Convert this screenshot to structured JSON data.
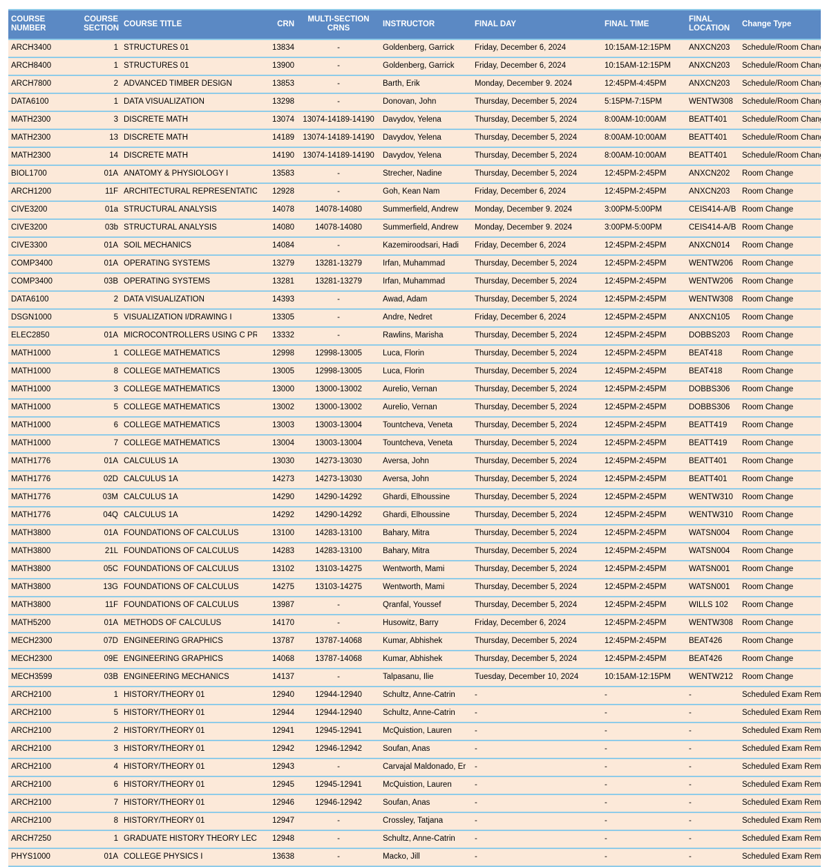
{
  "table": {
    "columns": [
      {
        "key": "course_number",
        "label": "COURSE\nNUMBER",
        "align": "left"
      },
      {
        "key": "course_section",
        "label": "COURSE\nSECTION",
        "align": "right"
      },
      {
        "key": "course_title",
        "label": "COURSE TITLE",
        "align": "left"
      },
      {
        "key": "crn",
        "label": "CRN",
        "align": "right"
      },
      {
        "key": "multi_section",
        "label": "MULTI-SECTION\nCRNS",
        "align": "center"
      },
      {
        "key": "instructor",
        "label": "INSTRUCTOR",
        "align": "left"
      },
      {
        "key": "final_day",
        "label": "FINAL DAY",
        "align": "left"
      },
      {
        "key": "final_time",
        "label": "FINAL TIME",
        "align": "left"
      },
      {
        "key": "final_location",
        "label": "FINAL\nLOCATION",
        "align": "left"
      },
      {
        "key": "change_type",
        "label": "Change Type",
        "align": "left"
      }
    ],
    "colors": {
      "header_background": "#5b89c4",
      "header_text": "#ffffff",
      "row_background": "#fce9d9",
      "row_separator": "#8ecbe8",
      "body_text": "#000000"
    },
    "rows": [
      {
        "course_number": "ARCH3400",
        "course_section": "1",
        "course_title": "STRUCTURES 01",
        "crn": "13834",
        "multi_section": "-",
        "instructor": "Goldenberg, Garrick",
        "final_day": "Friday, December 6, 2024",
        "final_time": "10:15AM-12:15PM",
        "final_location": "ANXCN203",
        "change_type": "Schedule/Room Change"
      },
      {
        "course_number": "ARCH8400",
        "course_section": "1",
        "course_title": "STRUCTURES 01",
        "crn": "13900",
        "multi_section": "-",
        "instructor": "Goldenberg, Garrick",
        "final_day": "Friday, December 6, 2024",
        "final_time": "10:15AM-12:15PM",
        "final_location": "ANXCN203",
        "change_type": "Schedule/Room Change"
      },
      {
        "course_number": "ARCH7800",
        "course_section": "2",
        "course_title": "ADVANCED TIMBER DESIGN",
        "crn": "13853",
        "multi_section": "-",
        "instructor": "Barth, Erik",
        "final_day": "Monday, December 9. 2024",
        "final_time": "12:45PM-4:45PM",
        "final_location": "ANXCN203",
        "change_type": "Schedule/Room Change"
      },
      {
        "course_number": "DATA6100",
        "course_section": "1",
        "course_title": "DATA VISUALIZATION",
        "crn": "13298",
        "multi_section": "-",
        "instructor": "Donovan, John",
        "final_day": "Thursday, December 5, 2024",
        "final_time": "5:15PM-7:15PM",
        "final_location": "WENTW308",
        "change_type": "Schedule/Room Change"
      },
      {
        "course_number": "MATH2300",
        "course_section": "3",
        "course_title": "DISCRETE MATH",
        "crn": "13074",
        "multi_section": "13074-14189-14190",
        "instructor": "Davydov, Yelena",
        "final_day": "Thursday, December 5, 2024",
        "final_time": "8:00AM-10:00AM",
        "final_location": "BEATT401",
        "change_type": "Schedule/Room Change"
      },
      {
        "course_number": "MATH2300",
        "course_section": "13",
        "course_title": "DISCRETE MATH",
        "crn": "14189",
        "multi_section": "13074-14189-14190",
        "instructor": "Davydov, Yelena",
        "final_day": "Thursday, December 5, 2024",
        "final_time": "8:00AM-10:00AM",
        "final_location": "BEATT401",
        "change_type": "Schedule/Room Change"
      },
      {
        "course_number": "MATH2300",
        "course_section": "14",
        "course_title": "DISCRETE MATH",
        "crn": "14190",
        "multi_section": "13074-14189-14190",
        "instructor": "Davydov, Yelena",
        "final_day": "Thursday, December 5, 2024",
        "final_time": "8:00AM-10:00AM",
        "final_location": "BEATT401",
        "change_type": "Schedule/Room Change"
      },
      {
        "course_number": "BIOL1700",
        "course_section": "01A",
        "course_title": "ANATOMY & PHYSIOLOGY I",
        "crn": "13583",
        "multi_section": "-",
        "instructor": "Strecher, Nadine",
        "final_day": "Thursday, December 5, 2024",
        "final_time": "12:45PM-2:45PM",
        "final_location": "ANXCN202",
        "change_type": "Room Change"
      },
      {
        "course_number": "ARCH1200",
        "course_section": "11F",
        "course_title": "ARCHITECTURAL REPRESENTATIC",
        "crn": "12928",
        "multi_section": "-",
        "instructor": "Goh, Kean Nam",
        "final_day": "Friday, December 6, 2024",
        "final_time": "12:45PM-2:45PM",
        "final_location": "ANXCN203",
        "change_type": "Room Change"
      },
      {
        "course_number": "CIVE3200",
        "course_section": "01a",
        "course_title": "STRUCTURAL ANALYSIS",
        "crn": "14078",
        "multi_section": "14078-14080",
        "instructor": "Summerfield, Andrew",
        "final_day": "Monday, December 9. 2024",
        "final_time": "3:00PM-5:00PM",
        "final_location": "CEIS414-A/B",
        "change_type": "Room Change"
      },
      {
        "course_number": "CIVE3200",
        "course_section": "03b",
        "course_title": "STRUCTURAL ANALYSIS",
        "crn": "14080",
        "multi_section": "14078-14080",
        "instructor": "Summerfield, Andrew",
        "final_day": "Monday, December 9. 2024",
        "final_time": "3:00PM-5:00PM",
        "final_location": "CEIS414-A/B",
        "change_type": "Room Change"
      },
      {
        "course_number": "CIVE3300",
        "course_section": "01A",
        "course_title": "SOIL MECHANICS",
        "crn": "14084",
        "multi_section": "-",
        "instructor": "Kazemiroodsari, Hadi",
        "final_day": "Friday, December 6, 2024",
        "final_time": "12:45PM-2:45PM",
        "final_location": "ANXCN014",
        "change_type": "Room Change"
      },
      {
        "course_number": "COMP3400",
        "course_section": "01A",
        "course_title": "OPERATING SYSTEMS",
        "crn": "13279",
        "multi_section": "13281-13279",
        "instructor": "Irfan, Muhammad",
        "final_day": "Thursday, December 5, 2024",
        "final_time": "12:45PM-2:45PM",
        "final_location": "WENTW206",
        "change_type": "Room Change"
      },
      {
        "course_number": "COMP3400",
        "course_section": "03B",
        "course_title": "OPERATING SYSTEMS",
        "crn": "13281",
        "multi_section": "13281-13279",
        "instructor": "Irfan, Muhammad",
        "final_day": "Thursday, December 5, 2024",
        "final_time": "12:45PM-2:45PM",
        "final_location": "WENTW206",
        "change_type": "Room Change"
      },
      {
        "course_number": "DATA6100",
        "course_section": "2",
        "course_title": "DATA VISUALIZATION",
        "crn": "14393",
        "multi_section": "-",
        "instructor": "Awad, Adam",
        "final_day": "Thursday, December 5, 2024",
        "final_time": "12:45PM-2:45PM",
        "final_location": "WENTW308",
        "change_type": "Room Change"
      },
      {
        "course_number": "DSGN1000",
        "course_section": "5",
        "course_title": "VISUALIZATION I/DRAWING I",
        "crn": "13305",
        "multi_section": "-",
        "instructor": "Andre, Nedret",
        "final_day": "Friday, December 6, 2024",
        "final_time": "12:45PM-2:45PM",
        "final_location": "ANXCN105",
        "change_type": "Room Change"
      },
      {
        "course_number": "ELEC2850",
        "course_section": "01A",
        "course_title": "MICROCONTROLLERS USING C PR",
        "crn": "13332",
        "multi_section": "-",
        "instructor": "Rawlins, Marisha",
        "final_day": "Thursday, December 5, 2024",
        "final_time": "12:45PM-2:45PM",
        "final_location": "DOBBS203",
        "change_type": "Room Change"
      },
      {
        "course_number": "MATH1000",
        "course_section": "1",
        "course_title": "COLLEGE MATHEMATICS",
        "crn": "12998",
        "multi_section": "12998-13005",
        "instructor": "Luca, Florin",
        "final_day": "Thursday, December 5, 2024",
        "final_time": "12:45PM-2:45PM",
        "final_location": "BEAT418",
        "change_type": "Room Change"
      },
      {
        "course_number": "MATH1000",
        "course_section": "8",
        "course_title": "COLLEGE MATHEMATICS",
        "crn": "13005",
        "multi_section": "12998-13005",
        "instructor": "Luca, Florin",
        "final_day": "Thursday, December 5, 2024",
        "final_time": "12:45PM-2:45PM",
        "final_location": "BEAT418",
        "change_type": "Room Change"
      },
      {
        "course_number": "MATH1000",
        "course_section": "3",
        "course_title": "COLLEGE MATHEMATICS",
        "crn": "13000",
        "multi_section": "13000-13002",
        "instructor": "Aurelio, Vernan",
        "final_day": "Thursday, December 5, 2024",
        "final_time": "12:45PM-2:45PM",
        "final_location": "DOBBS306",
        "change_type": "Room Change"
      },
      {
        "course_number": "MATH1000",
        "course_section": "5",
        "course_title": "COLLEGE MATHEMATICS",
        "crn": "13002",
        "multi_section": "13000-13002",
        "instructor": "Aurelio, Vernan",
        "final_day": "Thursday, December 5, 2024",
        "final_time": "12:45PM-2:45PM",
        "final_location": "DOBBS306",
        "change_type": "Room Change"
      },
      {
        "course_number": "MATH1000",
        "course_section": "6",
        "course_title": "COLLEGE MATHEMATICS",
        "crn": "13003",
        "multi_section": "13003-13004",
        "instructor": "Tountcheva, Veneta",
        "final_day": "Thursday, December 5, 2024",
        "final_time": "12:45PM-2:45PM",
        "final_location": "BEATT419",
        "change_type": "Room Change"
      },
      {
        "course_number": "MATH1000",
        "course_section": "7",
        "course_title": "COLLEGE MATHEMATICS",
        "crn": "13004",
        "multi_section": "13003-13004",
        "instructor": "Tountcheva, Veneta",
        "final_day": "Thursday, December 5, 2024",
        "final_time": "12:45PM-2:45PM",
        "final_location": "BEATT419",
        "change_type": "Room Change"
      },
      {
        "course_number": "MATH1776",
        "course_section": "01A",
        "course_title": "CALCULUS 1A",
        "crn": "13030",
        "multi_section": "14273-13030",
        "instructor": "Aversa, John",
        "final_day": "Thursday, December 5, 2024",
        "final_time": "12:45PM-2:45PM",
        "final_location": "BEATT401",
        "change_type": "Room Change"
      },
      {
        "course_number": "MATH1776",
        "course_section": "02D",
        "course_title": "CALCULUS 1A",
        "crn": "14273",
        "multi_section": "14273-13030",
        "instructor": "Aversa, John",
        "final_day": "Thursday, December 5, 2024",
        "final_time": "12:45PM-2:45PM",
        "final_location": "BEATT401",
        "change_type": "Room Change"
      },
      {
        "course_number": "MATH1776",
        "course_section": "03M",
        "course_title": "CALCULUS 1A",
        "crn": "14290",
        "multi_section": "14290-14292",
        "instructor": "Ghardi, Elhoussine",
        "final_day": "Thursday, December 5, 2024",
        "final_time": "12:45PM-2:45PM",
        "final_location": "WENTW310",
        "change_type": "Room Change"
      },
      {
        "course_number": "MATH1776",
        "course_section": "04Q",
        "course_title": "CALCULUS 1A",
        "crn": "14292",
        "multi_section": "14290-14292",
        "instructor": "Ghardi, Elhoussine",
        "final_day": "Thursday, December 5, 2024",
        "final_time": "12:45PM-2:45PM",
        "final_location": "WENTW310",
        "change_type": "Room Change"
      },
      {
        "course_number": "MATH3800",
        "course_section": "01A",
        "course_title": "FOUNDATIONS OF CALCULUS",
        "crn": "13100",
        "multi_section": "14283-13100",
        "instructor": "Bahary, Mitra",
        "final_day": "Thursday, December 5, 2024",
        "final_time": "12:45PM-2:45PM",
        "final_location": "WATSN004",
        "change_type": "Room Change"
      },
      {
        "course_number": "MATH3800",
        "course_section": "21L",
        "course_title": "FOUNDATIONS OF CALCULUS",
        "crn": "14283",
        "multi_section": "14283-13100",
        "instructor": "Bahary, Mitra",
        "final_day": "Thursday, December 5, 2024",
        "final_time": "12:45PM-2:45PM",
        "final_location": "WATSN004",
        "change_type": "Room Change"
      },
      {
        "course_number": "MATH3800",
        "course_section": "05C",
        "course_title": "FOUNDATIONS OF CALCULUS",
        "crn": "13102",
        "multi_section": "13103-14275",
        "instructor": "Wentworth, Mami",
        "final_day": "Thursday, December 5, 2024",
        "final_time": "12:45PM-2:45PM",
        "final_location": "WATSN001",
        "change_type": "Room Change"
      },
      {
        "course_number": "MATH3800",
        "course_section": "13G",
        "course_title": "FOUNDATIONS OF CALCULUS",
        "crn": "14275",
        "multi_section": "13103-14275",
        "instructor": "Wentworth, Mami",
        "final_day": "Thursday, December 5, 2024",
        "final_time": "12:45PM-2:45PM",
        "final_location": "WATSN001",
        "change_type": "Room Change"
      },
      {
        "course_number": "MATH3800",
        "course_section": "11F",
        "course_title": "FOUNDATIONS OF CALCULUS",
        "crn": "13987",
        "multi_section": "-",
        "instructor": "Qranfal, Youssef",
        "final_day": "Thursday, December 5, 2024",
        "final_time": "12:45PM-2:45PM",
        "final_location": "WILLS 102",
        "change_type": "Room Change"
      },
      {
        "course_number": "MATH5200",
        "course_section": "01A",
        "course_title": "METHODS OF CALCULUS",
        "crn": "14170",
        "multi_section": "-",
        "instructor": "Husowitz, Barry",
        "final_day": "Friday, December 6, 2024",
        "final_time": "12:45PM-2:45PM",
        "final_location": "WENTW308",
        "change_type": "Room Change"
      },
      {
        "course_number": "MECH2300",
        "course_section": "07D",
        "course_title": "ENGINEERING GRAPHICS",
        "crn": "13787",
        "multi_section": "13787-14068",
        "instructor": "Kumar, Abhishek",
        "final_day": "Thursday, December 5, 2024",
        "final_time": "12:45PM-2:45PM",
        "final_location": "BEAT426",
        "change_type": "Room Change"
      },
      {
        "course_number": "MECH2300",
        "course_section": "09E",
        "course_title": "ENGINEERING GRAPHICS",
        "crn": "14068",
        "multi_section": "13787-14068",
        "instructor": "Kumar, Abhishek",
        "final_day": "Thursday, December 5, 2024",
        "final_time": "12:45PM-2:45PM",
        "final_location": "BEAT426",
        "change_type": "Room Change"
      },
      {
        "course_number": "MECH3599",
        "course_section": "03B",
        "course_title": "ENGINEERING MECHANICS",
        "crn": "14137",
        "multi_section": "-",
        "instructor": "Talpasanu, Ilie",
        "final_day": "Tuesday, December 10, 2024",
        "final_time": "10:15AM-12:15PM",
        "final_location": "WENTW212",
        "change_type": "Room Change"
      },
      {
        "course_number": "ARCH2100",
        "course_section": "1",
        "course_title": "HISTORY/THEORY 01",
        "crn": "12940",
        "multi_section": "12944-12940",
        "instructor": "Schultz, Anne-Catrin",
        "final_day": "-",
        "final_time": "-",
        "final_location": "-",
        "change_type": "Scheduled Exam Removed"
      },
      {
        "course_number": "ARCH2100",
        "course_section": "5",
        "course_title": "HISTORY/THEORY 01",
        "crn": "12944",
        "multi_section": "12944-12940",
        "instructor": "Schultz, Anne-Catrin",
        "final_day": "-",
        "final_time": "-",
        "final_location": "-",
        "change_type": "Scheduled Exam Removed"
      },
      {
        "course_number": "ARCH2100",
        "course_section": "2",
        "course_title": "HISTORY/THEORY 01",
        "crn": "12941",
        "multi_section": "12945-12941",
        "instructor": "McQuistion, Lauren",
        "final_day": "-",
        "final_time": "-",
        "final_location": "-",
        "change_type": "Scheduled Exam Removed"
      },
      {
        "course_number": "ARCH2100",
        "course_section": "3",
        "course_title": "HISTORY/THEORY 01",
        "crn": "12942",
        "multi_section": "12946-12942",
        "instructor": "Soufan, Anas",
        "final_day": "-",
        "final_time": "-",
        "final_location": "-",
        "change_type": "Scheduled Exam Removed"
      },
      {
        "course_number": "ARCH2100",
        "course_section": "4",
        "course_title": "HISTORY/THEORY 01",
        "crn": "12943",
        "multi_section": "-",
        "instructor": "Carvajal Maldonado, Er",
        "final_day": "-",
        "final_time": "-",
        "final_location": "-",
        "change_type": "Scheduled Exam Removed"
      },
      {
        "course_number": "ARCH2100",
        "course_section": "6",
        "course_title": "HISTORY/THEORY 01",
        "crn": "12945",
        "multi_section": "12945-12941",
        "instructor": "McQuistion, Lauren",
        "final_day": "-",
        "final_time": "-",
        "final_location": "-",
        "change_type": "Scheduled Exam Removed"
      },
      {
        "course_number": "ARCH2100",
        "course_section": "7",
        "course_title": "HISTORY/THEORY 01",
        "crn": "12946",
        "multi_section": "12946-12942",
        "instructor": "Soufan, Anas",
        "final_day": "-",
        "final_time": "-",
        "final_location": "-",
        "change_type": "Scheduled Exam Removed"
      },
      {
        "course_number": "ARCH2100",
        "course_section": "8",
        "course_title": "HISTORY/THEORY 01",
        "crn": "12947",
        "multi_section": "-",
        "instructor": "Crossley, Tatjana",
        "final_day": "-",
        "final_time": "-",
        "final_location": "-",
        "change_type": "Scheduled Exam Removed"
      },
      {
        "course_number": "ARCH7250",
        "course_section": "1",
        "course_title": "GRADUATE HISTORY THEORY LEC",
        "crn": "12948",
        "multi_section": "-",
        "instructor": "Schultz, Anne-Catrin",
        "final_day": "-",
        "final_time": "-",
        "final_location": "-",
        "change_type": "Scheduled Exam Removed"
      },
      {
        "course_number": "PHYS1000",
        "course_section": "01A",
        "course_title": "COLLEGE PHYSICS I",
        "crn": "13638",
        "multi_section": "-",
        "instructor": "Macko, Jill",
        "final_day": "-",
        "final_time": "-",
        "final_location": "-",
        "change_type": "Scheduled Exam Removed"
      }
    ]
  }
}
